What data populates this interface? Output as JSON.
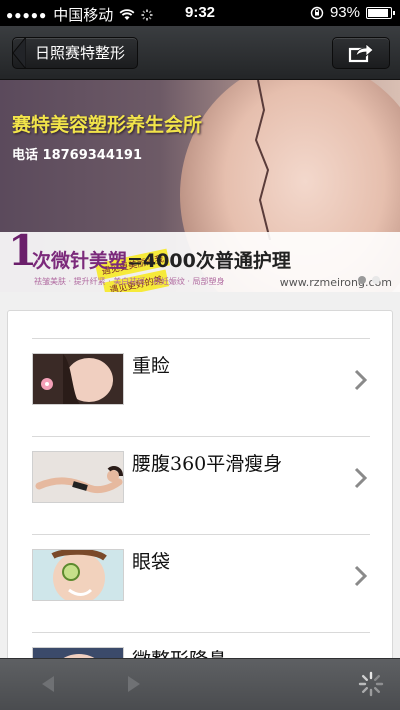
{
  "status_bar": {
    "carrier": "中国移动",
    "time": "9:32",
    "battery_percent": "93%",
    "battery_level": 0.93
  },
  "nav": {
    "back_label": "日照赛特整形",
    "share_icon": "share-icon"
  },
  "banner": {
    "title": "赛特美容塑形养生会所",
    "phone": "电话 18769344191",
    "tag1": "遇见更美丽的我",
    "tag2": "遇见更好的美",
    "big_number": "1",
    "promo_highlight": "次微针美塑",
    "promo_rest": "=4000次普通护理",
    "promo_sub": "祛皱美肤 · 提升纤紧 · 美白祛斑 · 祛妊娠纹 · 局部塑身",
    "url": "www.rzmeirong.com",
    "slide_count": 2,
    "active_slide": 2
  },
  "list": {
    "items": [
      {
        "title": "重睑",
        "thumb_icon": "face-flower-thumbnail"
      },
      {
        "title": "腰腹360平滑瘦身",
        "thumb_icon": "reclining-body-thumbnail"
      },
      {
        "title": "眼袋",
        "thumb_icon": "cucumber-eye-thumbnail"
      },
      {
        "title": "微整形隆鼻",
        "thumb_icon": "face-thumbnail"
      }
    ]
  },
  "toolbar": {
    "back_icon": "left-triangle-icon",
    "forward_icon": "right-triangle-icon",
    "loading_icon": "spinner-icon"
  },
  "colors": {
    "promo_purple": "#7b2a7b",
    "title_yellow": "#f2e44a",
    "nav_dark": "#232527"
  }
}
